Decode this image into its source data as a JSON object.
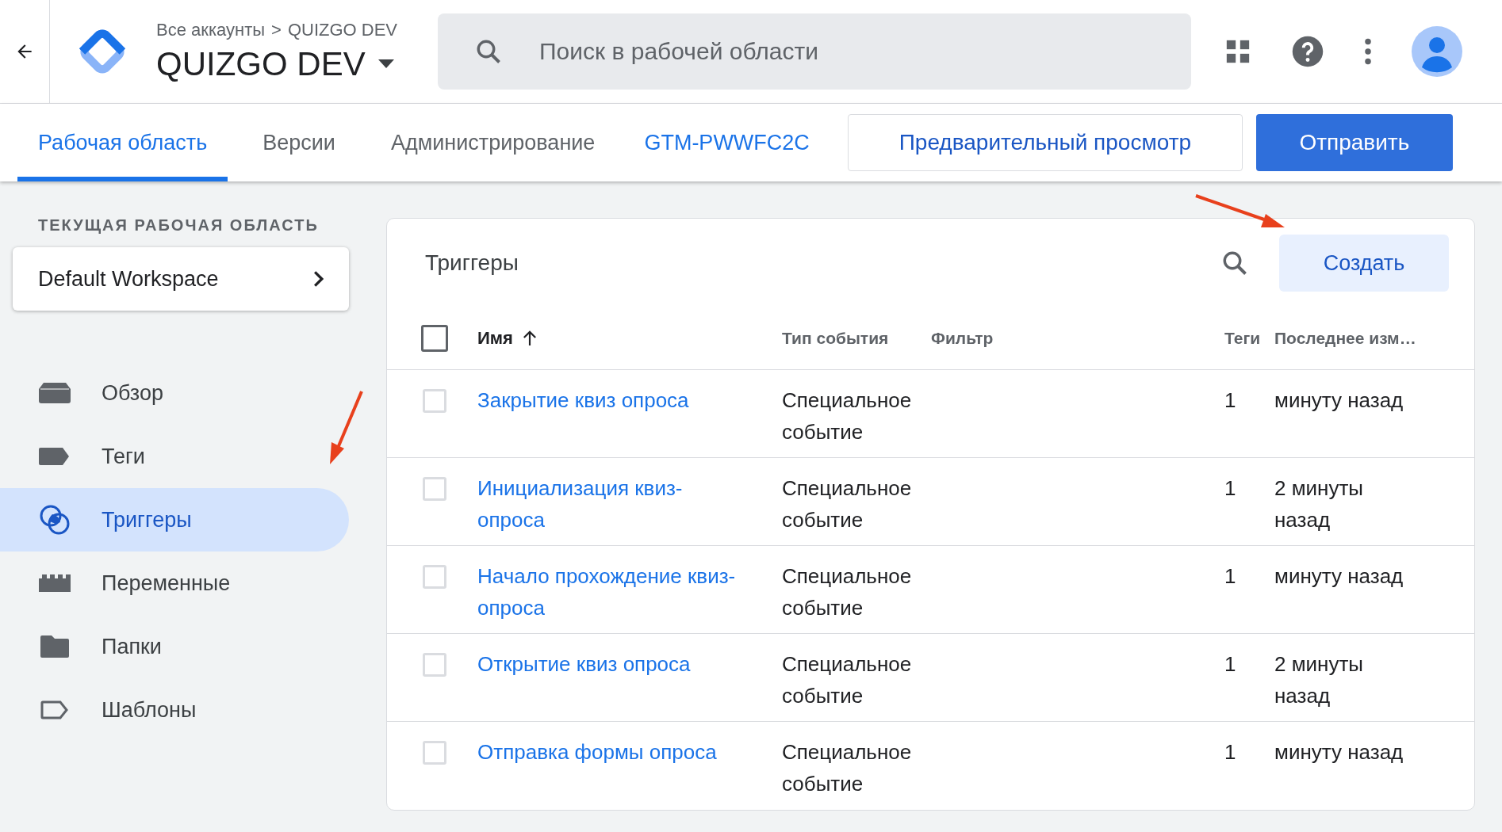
{
  "header": {
    "breadcrumb": {
      "parent": "Все аккаунты",
      "separator": ">",
      "current": "QUIZGO DEV"
    },
    "container_name": "QUIZGO DEV",
    "search": {
      "placeholder": "Поиск в рабочей области"
    }
  },
  "nav": {
    "tabs": [
      {
        "label": "Рабочая область",
        "selected": true
      },
      {
        "label": "Версии",
        "selected": false
      },
      {
        "label": "Администрирование",
        "selected": false
      }
    ],
    "container_id": "GTM-PWWFC2C",
    "preview_button": "Предварительный просмотр",
    "submit_button": "Отправить"
  },
  "sidebar": {
    "section_label": "ТЕКУЩАЯ РАБОЧАЯ ОБЛАСТЬ",
    "workspace": "Default Workspace",
    "items": [
      {
        "label": "Обзор",
        "kind": "overview",
        "selected": false
      },
      {
        "label": "Теги",
        "kind": "tags",
        "selected": false
      },
      {
        "label": "Триггеры",
        "kind": "triggers",
        "selected": true
      },
      {
        "label": "Переменные",
        "kind": "variables",
        "selected": false
      },
      {
        "label": "Папки",
        "kind": "folders",
        "selected": false
      },
      {
        "label": "Шаблоны",
        "kind": "templates",
        "selected": false
      }
    ]
  },
  "triggers": {
    "title": "Триггеры",
    "create_button": "Создать",
    "select_all_checked": false,
    "columns": [
      {
        "label": "Имя",
        "sorted": true
      },
      {
        "label": "Тип события",
        "sorted": false
      },
      {
        "label": "Фильтр",
        "sorted": false
      },
      {
        "label": "Теги",
        "sorted": false
      },
      {
        "label": "Последнее изм…",
        "sorted": false
      }
    ],
    "rows": [
      {
        "name": "Закрытие квиз опроса",
        "event_type": "Специальное событие",
        "tags": "1",
        "last_modified": "минуту назад",
        "checked": false
      },
      {
        "name": "Инициализация квиз-опроса",
        "event_type": "Специальное событие",
        "tags": "1",
        "last_modified": "2 минуты назад",
        "checked": false
      },
      {
        "name": "Начало прохождение квиз-опроса",
        "event_type": "Специальное событие",
        "tags": "1",
        "last_modified": "минуту назад",
        "checked": false
      },
      {
        "name": "Открытие квиз опроса",
        "event_type": "Специальное событие",
        "tags": "1",
        "last_modified": "2 минуты назад",
        "checked": false
      },
      {
        "name": "Отправка формы опроса",
        "event_type": "Специальное событие",
        "tags": "1",
        "last_modified": "минуту назад",
        "checked": false
      }
    ]
  }
}
